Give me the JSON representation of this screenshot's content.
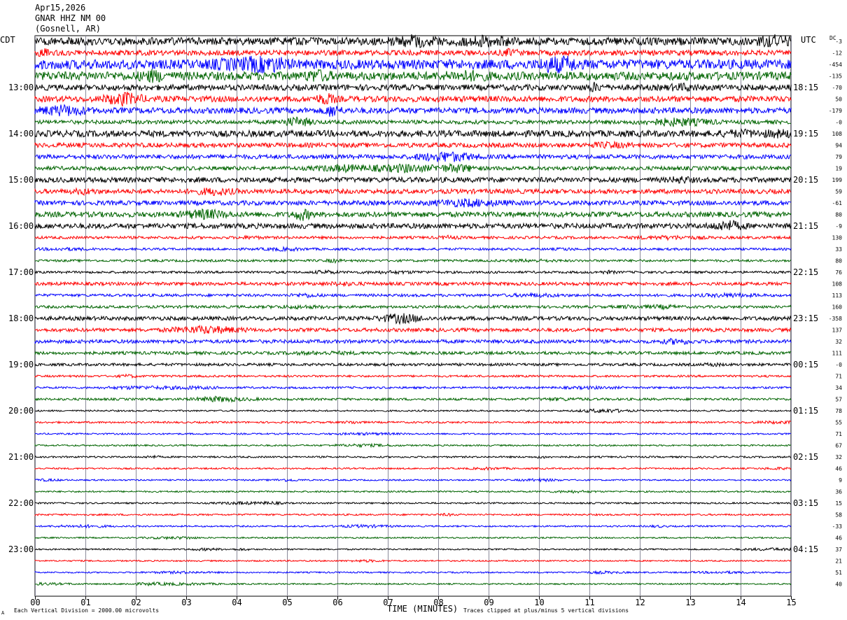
{
  "header": {
    "date": "Apr15,2026",
    "station": "GNAR HHZ NM 00",
    "location": "(Gosnell, AR)"
  },
  "left_tz": "CDT",
  "right_tz": "UTC",
  "dc_label": "DC",
  "footer": {
    "scale_note": "Each Vertical Division = 2000.00 microvolts",
    "clip_note": "Traces clipped at plus/minus 5 vertical divisions",
    "corner_mark": "A"
  },
  "chart_data": {
    "type": "helicorder",
    "title": "",
    "xlabel": "TIME (MINUTES)",
    "ylabel": "",
    "xlim": [
      0,
      15
    ],
    "x_ticks": [
      "00",
      "01",
      "02",
      "03",
      "04",
      "05",
      "06",
      "07",
      "08",
      "09",
      "10",
      "11",
      "12",
      "13",
      "14",
      "15"
    ],
    "grid": true,
    "trace_colors": [
      "#000000",
      "#ff0000",
      "#0000ff",
      "#006400"
    ],
    "left_hour_labels": [
      "13:00",
      "14:00",
      "15:00",
      "16:00",
      "17:00",
      "18:00",
      "19:00",
      "20:00",
      "21:00",
      "22:00",
      "23:00"
    ],
    "right_hour_labels": [
      "18:15",
      "19:15",
      "20:15",
      "21:15",
      "22:15",
      "23:15",
      "00:15",
      "01:15",
      "02:15",
      "03:15",
      "04:15"
    ],
    "hour_label_first_row": 4,
    "dc_offsets": [
      "-3",
      "-12",
      "-454",
      "-135",
      "-70",
      "50",
      "-179",
      "-0",
      "108",
      "94",
      "79",
      "19",
      "199",
      "59",
      "-61",
      "80",
      "-9",
      "130",
      "33",
      "80",
      "76",
      "108",
      "113",
      "160",
      "-358",
      "137",
      "32",
      "111",
      "-0",
      "71",
      "34",
      "57",
      "78",
      "55",
      "71",
      "67",
      "32",
      "46",
      "9",
      "36",
      "15",
      "58",
      "-33",
      "46",
      "37",
      "21",
      "51",
      "40"
    ],
    "activity": [
      0.55,
      0.35,
      0.7,
      0.6,
      0.4,
      0.4,
      0.4,
      0.25,
      0.45,
      0.3,
      0.28,
      0.25,
      0.35,
      0.3,
      0.3,
      0.35,
      0.35,
      0.15,
      0.12,
      0.12,
      0.12,
      0.2,
      0.15,
      0.15,
      0.25,
      0.22,
      0.22,
      0.18,
      0.15,
      0.1,
      0.1,
      0.12,
      0.06,
      0.08,
      0.06,
      0.06,
      0.07,
      0.06,
      0.05,
      0.06,
      0.06,
      0.07,
      0.06,
      0.05,
      0.05,
      0.05,
      0.05,
      0.05
    ]
  }
}
